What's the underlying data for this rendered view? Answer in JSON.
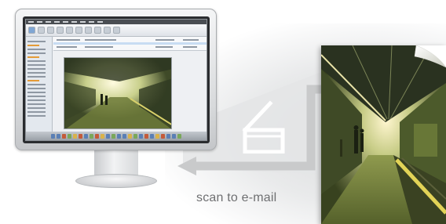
{
  "caption": "scan to e-mail",
  "icons": {
    "monitor": "computer-monitor-icon",
    "scanner": "flatbed-scanner-icon",
    "arrow": "left-arrow-icon"
  },
  "colors": {
    "caption": "#6e6f71",
    "arrow": "#c9cacb",
    "photo_tint": "#b9c26a"
  }
}
